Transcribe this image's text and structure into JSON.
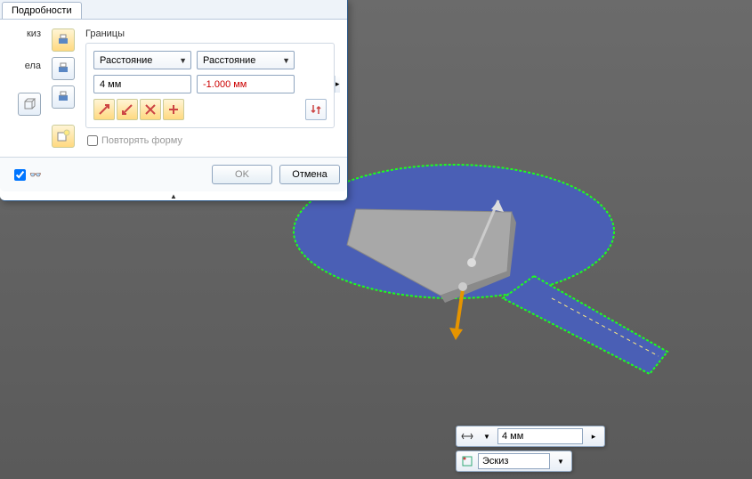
{
  "dialog": {
    "tab": "Подробности",
    "left_labels": {
      "sketch": "киз",
      "body": "ела"
    },
    "bounds": {
      "title": "Границы",
      "combo1": "Расстояние",
      "combo2": "Расстояние",
      "val1": "4 мм",
      "val2": "-1.000 мм"
    },
    "repeat_label": "Повторять форму",
    "ok": "OK",
    "cancel": "Отмена"
  },
  "floatbar": {
    "value": "4 мм",
    "sketch": "Эскиз"
  }
}
